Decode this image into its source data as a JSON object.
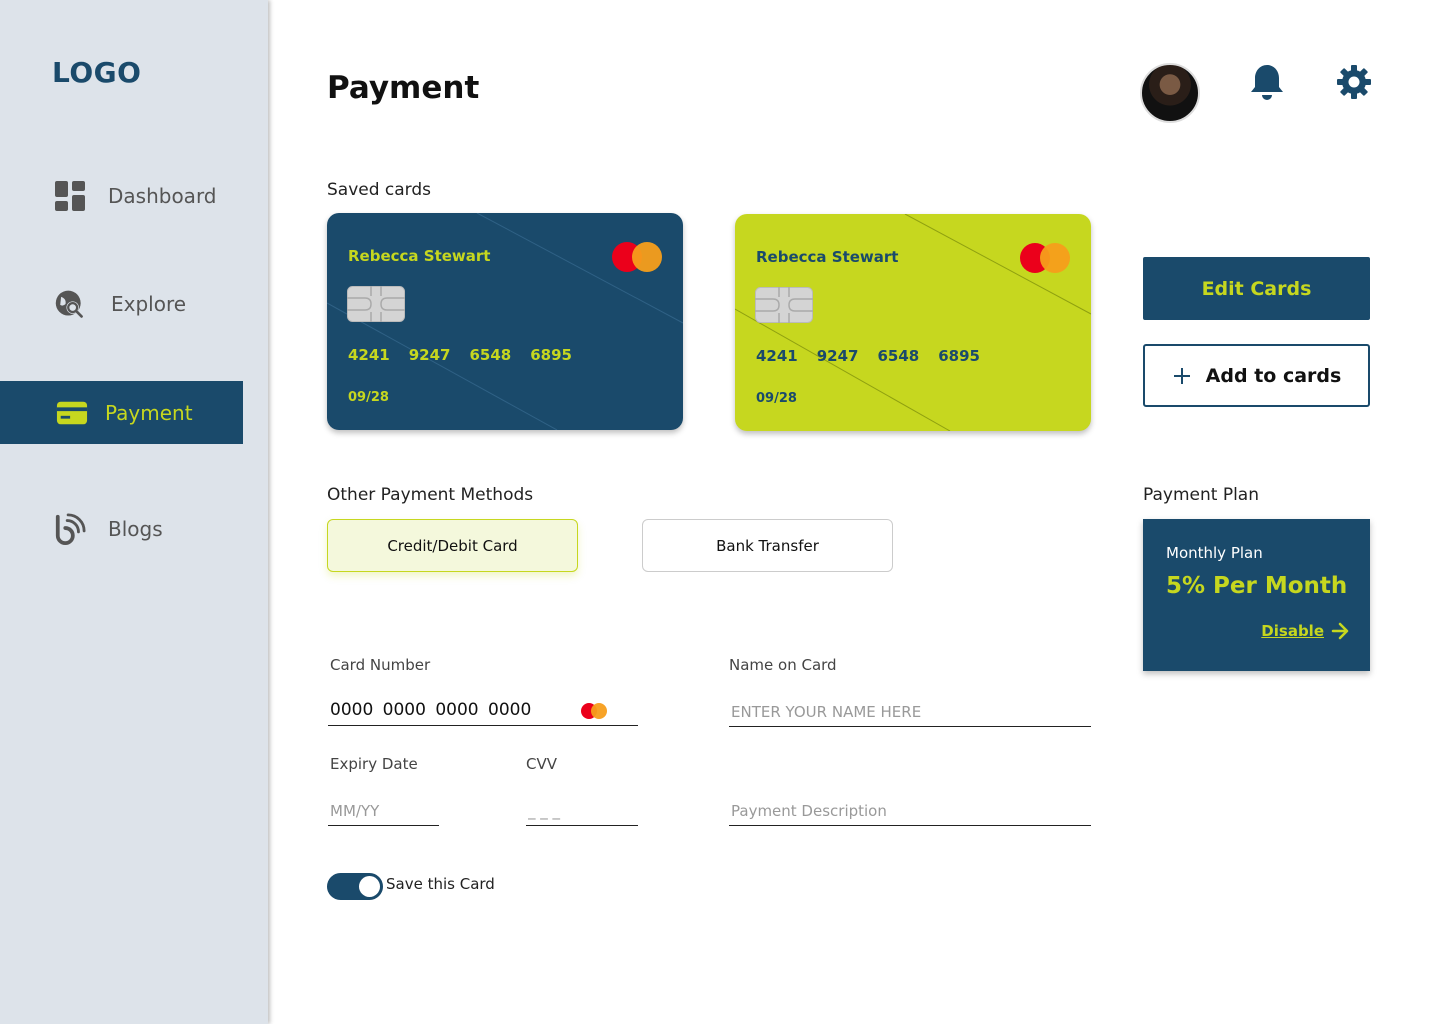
{
  "sidebar": {
    "logo": "LOGO",
    "items": [
      {
        "label": "Dashboard",
        "icon": "dashboard-icon"
      },
      {
        "label": "Explore",
        "icon": "explore-icon"
      },
      {
        "label": "Payment",
        "icon": "payment-card-icon",
        "active": true
      },
      {
        "label": "Blogs",
        "icon": "blogs-icon"
      }
    ]
  },
  "header": {
    "title": "Payment",
    "icons": [
      "avatar",
      "bell-icon",
      "gear-icon"
    ]
  },
  "saved_cards": {
    "label": "Saved cards",
    "cards": [
      {
        "holder": "Rebecca Stewart",
        "number_groups": [
          "4241",
          "9247",
          "6548",
          "6895"
        ],
        "expiry": "09/28",
        "bg": "#1a4a6b",
        "fg": "#c6d71f"
      },
      {
        "holder": "Rebecca Stewart",
        "number_groups": [
          "4241",
          "9247",
          "6548",
          "6895"
        ],
        "expiry": "09/28",
        "bg": "#c6d71f",
        "fg": "#1a4a6b"
      }
    ]
  },
  "actions": {
    "edit_label": "Edit Cards",
    "add_label": "Add to cards"
  },
  "other_methods": {
    "label": "Other Payment Methods",
    "options": [
      "Credit/Debit Card",
      "Bank Transfer"
    ],
    "selected": "Credit/Debit Card"
  },
  "plan": {
    "section_label": "Payment Plan",
    "name": "Monthly Plan",
    "rate": "5% Per Month",
    "action": "Disable"
  },
  "form": {
    "card_number_label": "Card Number",
    "card_number_value": "0000  0000  0000  0000",
    "name_label": "Name on Card",
    "name_placeholder": "ENTER YOUR NAME HERE",
    "expiry_label": "Expiry Date",
    "expiry_placeholder": "MM/YY",
    "cvv_label": "CVV",
    "cvv_placeholder": "_ _ _",
    "description_placeholder": "Payment Description",
    "save_toggle_label": "Save this Card",
    "save_toggle_on": true
  },
  "colors": {
    "primary": "#1a4a6b",
    "accent": "#c6d71f",
    "sidebar_bg": "#dde3ea",
    "mastercard_red": "#eb001b",
    "mastercard_orange": "#f79e1b"
  }
}
